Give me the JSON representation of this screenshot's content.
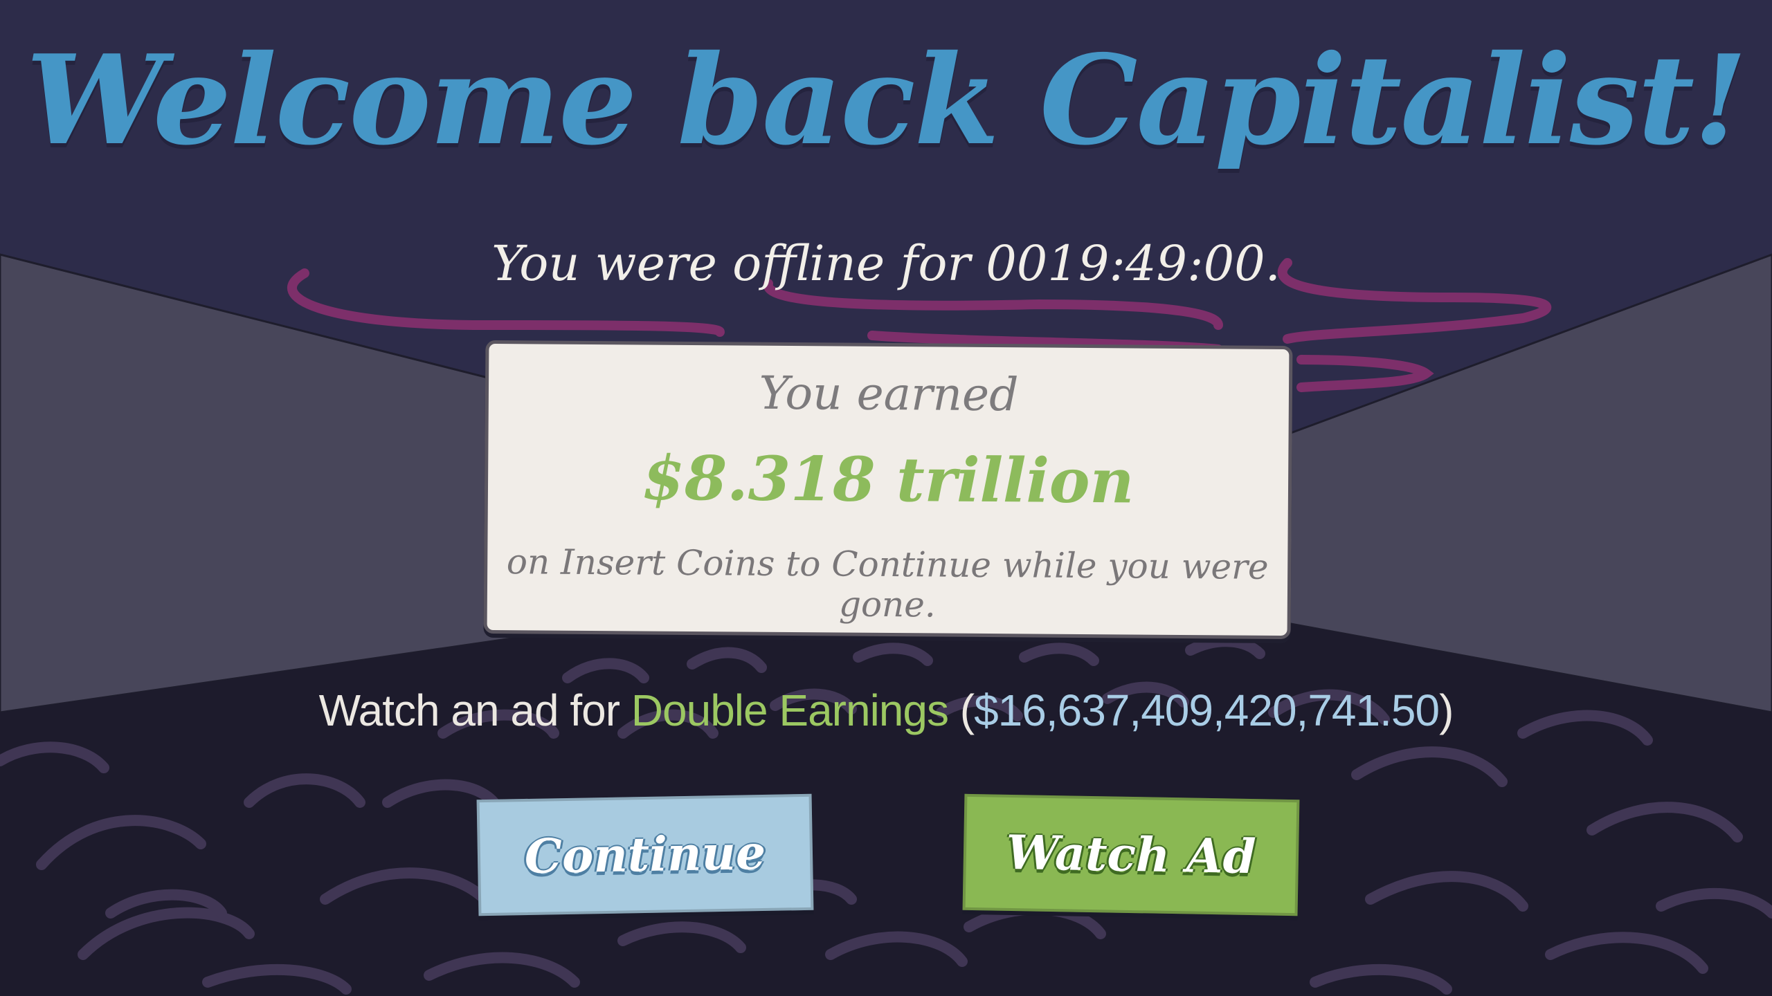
{
  "header": {
    "title": "Welcome back Capitalist!",
    "offline_prefix": "You were offline for ",
    "offline_time": "0019:49:00."
  },
  "panel": {
    "label": "You earned",
    "amount": "$8.318 trillion",
    "note": "on Insert Coins to Continue while you were gone."
  },
  "ad_offer": {
    "prefix": "Watch an ad for ",
    "highlight": "Double Earnings",
    "paren_open": " (",
    "amount": "$16,637,409,420,741.50",
    "paren_close": ")"
  },
  "buttons": {
    "continue_label": "Continue",
    "watch_ad_label": "Watch Ad"
  },
  "colors": {
    "title": "#4596c6",
    "earned_amount": "#8dbb5c",
    "continue_button": "#a8cbe0",
    "watch_ad_button": "#8ab853",
    "background": "#2d2c4a"
  }
}
